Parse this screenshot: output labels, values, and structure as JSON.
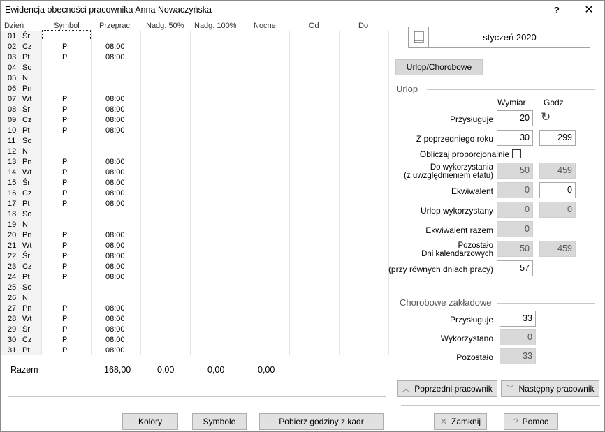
{
  "window": {
    "title": "Ewidencja obecności pracownika Anna Nowaczyńska",
    "help_glyph": "?",
    "close_glyph": "✕"
  },
  "grid": {
    "headers": [
      "Dzień",
      "Symbol",
      "Przeprac.",
      "Nadg. 50%",
      "Nadg. 100%",
      "Nocne",
      "Od",
      "Do"
    ],
    "rows": [
      {
        "num": "01",
        "dow": "Śr",
        "sym": "",
        "hrs": ""
      },
      {
        "num": "02",
        "dow": "Cz",
        "sym": "P",
        "hrs": "08:00"
      },
      {
        "num": "03",
        "dow": "Pt",
        "sym": "P",
        "hrs": "08:00"
      },
      {
        "num": "04",
        "dow": "So",
        "sym": "",
        "hrs": ""
      },
      {
        "num": "05",
        "dow": "N",
        "sym": "",
        "hrs": ""
      },
      {
        "num": "06",
        "dow": "Pn",
        "sym": "",
        "hrs": ""
      },
      {
        "num": "07",
        "dow": "Wt",
        "sym": "P",
        "hrs": "08:00"
      },
      {
        "num": "08",
        "dow": "Śr",
        "sym": "P",
        "hrs": "08:00"
      },
      {
        "num": "09",
        "dow": "Cz",
        "sym": "P",
        "hrs": "08:00"
      },
      {
        "num": "10",
        "dow": "Pt",
        "sym": "P",
        "hrs": "08:00"
      },
      {
        "num": "11",
        "dow": "So",
        "sym": "",
        "hrs": ""
      },
      {
        "num": "12",
        "dow": "N",
        "sym": "",
        "hrs": ""
      },
      {
        "num": "13",
        "dow": "Pn",
        "sym": "P",
        "hrs": "08:00"
      },
      {
        "num": "14",
        "dow": "Wt",
        "sym": "P",
        "hrs": "08:00"
      },
      {
        "num": "15",
        "dow": "Śr",
        "sym": "P",
        "hrs": "08:00"
      },
      {
        "num": "16",
        "dow": "Cz",
        "sym": "P",
        "hrs": "08:00"
      },
      {
        "num": "17",
        "dow": "Pt",
        "sym": "P",
        "hrs": "08:00"
      },
      {
        "num": "18",
        "dow": "So",
        "sym": "",
        "hrs": ""
      },
      {
        "num": "19",
        "dow": "N",
        "sym": "",
        "hrs": ""
      },
      {
        "num": "20",
        "dow": "Pn",
        "sym": "P",
        "hrs": "08:00"
      },
      {
        "num": "21",
        "dow": "Wt",
        "sym": "P",
        "hrs": "08:00"
      },
      {
        "num": "22",
        "dow": "Śr",
        "sym": "P",
        "hrs": "08:00"
      },
      {
        "num": "23",
        "dow": "Cz",
        "sym": "P",
        "hrs": "08:00"
      },
      {
        "num": "24",
        "dow": "Pt",
        "sym": "P",
        "hrs": "08:00"
      },
      {
        "num": "25",
        "dow": "So",
        "sym": "",
        "hrs": ""
      },
      {
        "num": "26",
        "dow": "N",
        "sym": "",
        "hrs": ""
      },
      {
        "num": "27",
        "dow": "Pn",
        "sym": "P",
        "hrs": "08:00"
      },
      {
        "num": "28",
        "dow": "Wt",
        "sym": "P",
        "hrs": "08:00"
      },
      {
        "num": "29",
        "dow": "Śr",
        "sym": "P",
        "hrs": "08:00"
      },
      {
        "num": "30",
        "dow": "Cz",
        "sym": "P",
        "hrs": "08:00"
      },
      {
        "num": "31",
        "dow": "Pt",
        "sym": "P",
        "hrs": "08:00"
      }
    ],
    "totals": {
      "label": "Razem",
      "worked": "168,00",
      "ot50": "0,00",
      "ot100": "0,00",
      "night": "0,00"
    }
  },
  "bottom_buttons": {
    "colors": "Kolory",
    "symbols": "Symbole",
    "fetch": "Pobierz godziny z kadr"
  },
  "panel": {
    "month": "styczeń 2020",
    "tab": "Urlop/Chorobowe",
    "urlop": {
      "title": "Urlop",
      "col_wymiar": "Wymiar",
      "col_godz": "Godz",
      "przysluguje_label": "Przysługuje",
      "przysluguje_value": "20",
      "reset_glyph": "↻",
      "z_poprz_label": "Z poprzedniego roku",
      "z_poprz_days": "30",
      "z_poprz_hours": "299",
      "proporcj_label": "Obliczaj proporcjonalnie",
      "do_wyk_label_1": "Do wykorzystania",
      "do_wyk_label_2": "(z uwzględnieniem etatu)",
      "do_wyk_days": "50",
      "do_wyk_hours": "459",
      "ekwiwalent_label": "Ekwiwalent",
      "ekwiwalent_days": "0",
      "ekwiwalent_hours": "0",
      "wykorzystany_label": "Urlop wykorzystany",
      "wykorzystany_days": "0",
      "wykorzystany_hours": "0",
      "ekw_razem_label": "Ekwiwalent razem",
      "ekw_razem_value": "0",
      "pozostalo_label_1": "Pozostało",
      "pozostalo_label_2": "Dni kalendarzowych",
      "pozostalo_days": "50",
      "pozostalo_hours": "459",
      "rownych_label": "(przy równych dniach pracy)",
      "rownych_value": "57"
    },
    "chorobowe": {
      "title": "Chorobowe zakładowe",
      "przysluguje_label": "Przysługuje",
      "przysluguje_value": "33",
      "wykorzystano_label": "Wykorzystano",
      "wykorzystano_value": "0",
      "pozostalo_label": "Pozostało",
      "pozostalo_value": "33"
    },
    "nav": {
      "prev": "Poprzedni pracownik",
      "next": "Następny pracownik",
      "prev_glyph": "︿",
      "next_glyph": "﹀"
    },
    "footer": {
      "close": "Zamknij",
      "close_glyph": "✕",
      "help": "Pomoc",
      "help_glyph": "?"
    }
  }
}
